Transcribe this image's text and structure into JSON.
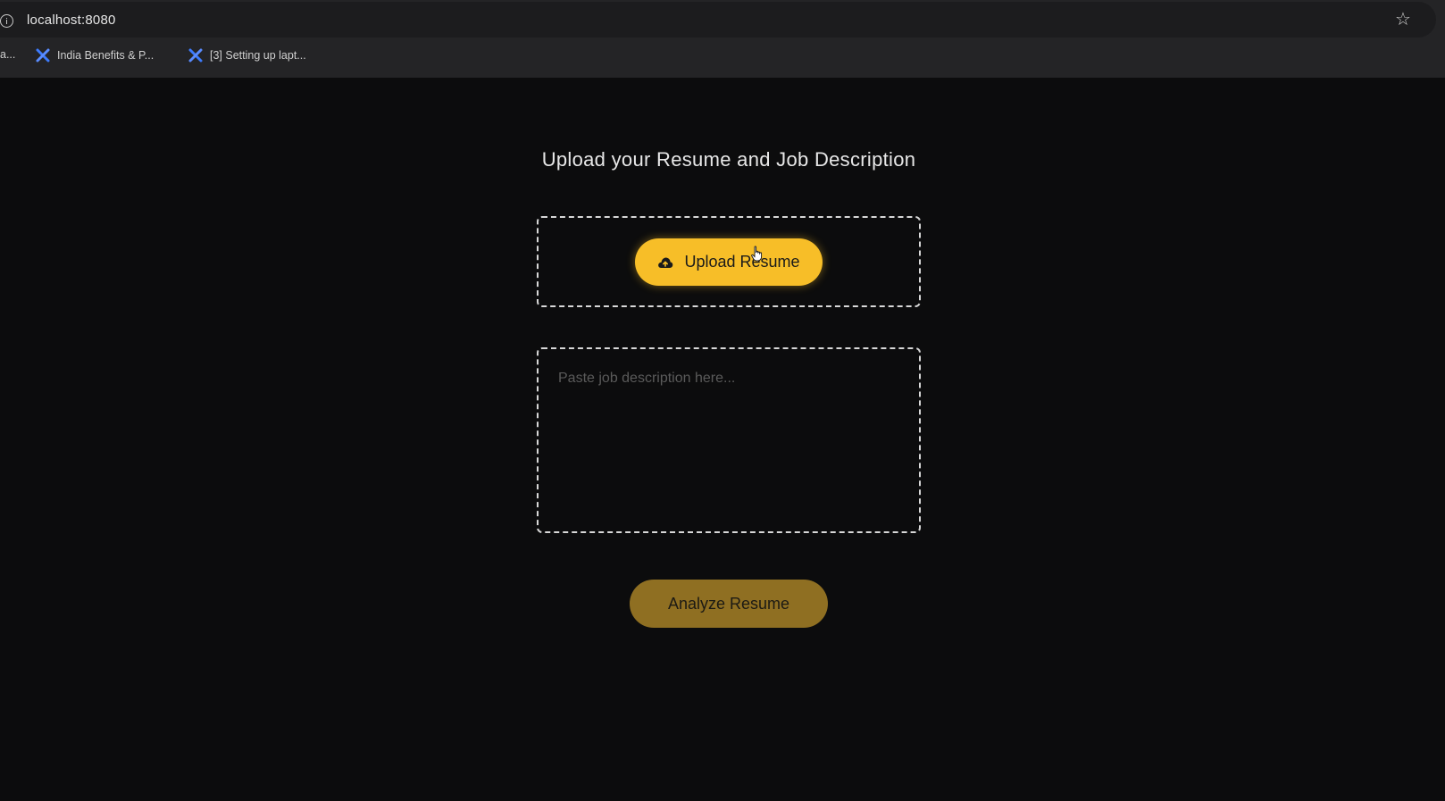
{
  "browser": {
    "url": "localhost:8080",
    "bookmarks": [
      {
        "label": "a..."
      },
      {
        "label": "India Benefits & P..."
      },
      {
        "label": "[3] Setting up lapt..."
      }
    ]
  },
  "page": {
    "title": "Upload your Resume and Job Description",
    "upload_button_label": "Upload Resume",
    "job_description_placeholder": "Paste job description here...",
    "job_description_value": "",
    "analyze_button_label": "Analyze Resume"
  },
  "colors": {
    "background": "#0c0c0d",
    "accent": "#f7be28",
    "accent_muted": "#8f6f22"
  },
  "icons": {
    "info": "info-icon",
    "star": "star-icon",
    "bookmark_favicon": "blue-x-icon",
    "upload": "cloud-upload-icon",
    "cursor": "hand-cursor-icon"
  }
}
